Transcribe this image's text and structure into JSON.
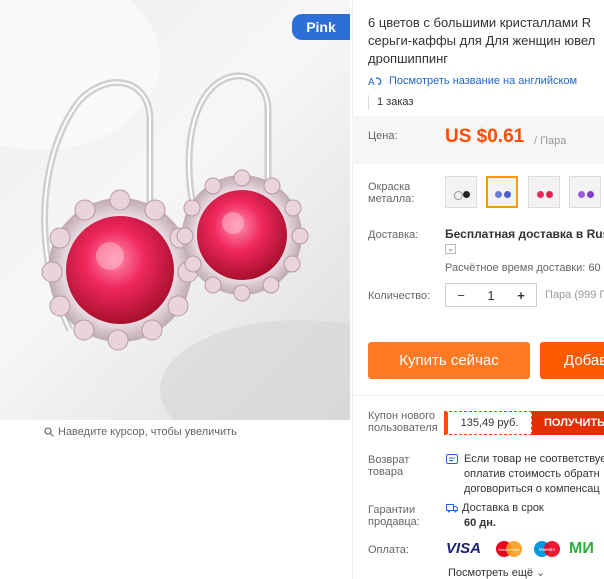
{
  "gallery": {
    "badge": "Pink",
    "zoom_hint": "Наведите курсор, чтобы увеличить"
  },
  "product": {
    "title_lines": [
      "6 цветов с большими кристаллами R",
      "серьги-каффы для Для женщин ювел",
      "дропшиппинг"
    ],
    "translate_link": "Посмотреть название на английском",
    "orders": "1 заказ"
  },
  "price": {
    "label": "Цена:",
    "value": "US $0.61",
    "unit": "/ Пара",
    "color": "#ff4c00"
  },
  "color_option": {
    "label_line1": "Окраска",
    "label_line2": "металла:",
    "swatches": [
      "white-black",
      "blue",
      "pink",
      "purple"
    ],
    "selected": 1
  },
  "shipping": {
    "label": "Доставка:",
    "main": "Бесплатная доставка в Russi",
    "time": "Расчётное время доставки: 60"
  },
  "quantity": {
    "label": "Количество:",
    "value": "1",
    "minus": "−",
    "plus": "+",
    "stock": "Пара (999 П"
  },
  "buttons": {
    "buy_now": "Купить сейчас",
    "add_cart": "Добав"
  },
  "coupon": {
    "label_lines": [
      "Купон нового",
      "пользователя"
    ],
    "value": "135,49 руб.",
    "get": "ПОЛУЧИТЬ"
  },
  "returns": {
    "label_lines": [
      "Возврат",
      "товара"
    ],
    "lines": [
      "Если товар не соответствуе",
      "оплатив стоимость обратн",
      "договориться о компенсац"
    ]
  },
  "guarantee": {
    "label_lines": [
      "Гарантии",
      "продавца:"
    ],
    "line1": "Доставка в срок",
    "line2": "60 дн."
  },
  "payment": {
    "label": "Оплата:",
    "visa": "VISA",
    "mc": "MasterCard",
    "maestro": "Maestro",
    "mir": "МИ"
  },
  "more_link": "Посмотреть ещё"
}
